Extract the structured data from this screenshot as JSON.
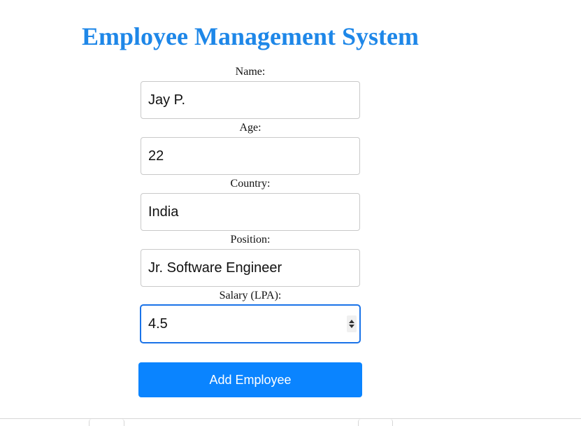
{
  "page": {
    "title": "Employee Management System"
  },
  "form": {
    "fields": [
      {
        "label": "Name:",
        "value": "Jay P."
      },
      {
        "label": "Age:",
        "value": "22"
      },
      {
        "label": "Country:",
        "value": "India"
      },
      {
        "label": "Position:",
        "value": "Jr. Software Engineer"
      },
      {
        "label": "Salary (LPA):",
        "value": "4.5"
      }
    ],
    "submit_label": "Add Employee"
  },
  "colors": {
    "title": "#1e87e8",
    "button": "#0a84ff",
    "focus": "#1a73e8"
  }
}
